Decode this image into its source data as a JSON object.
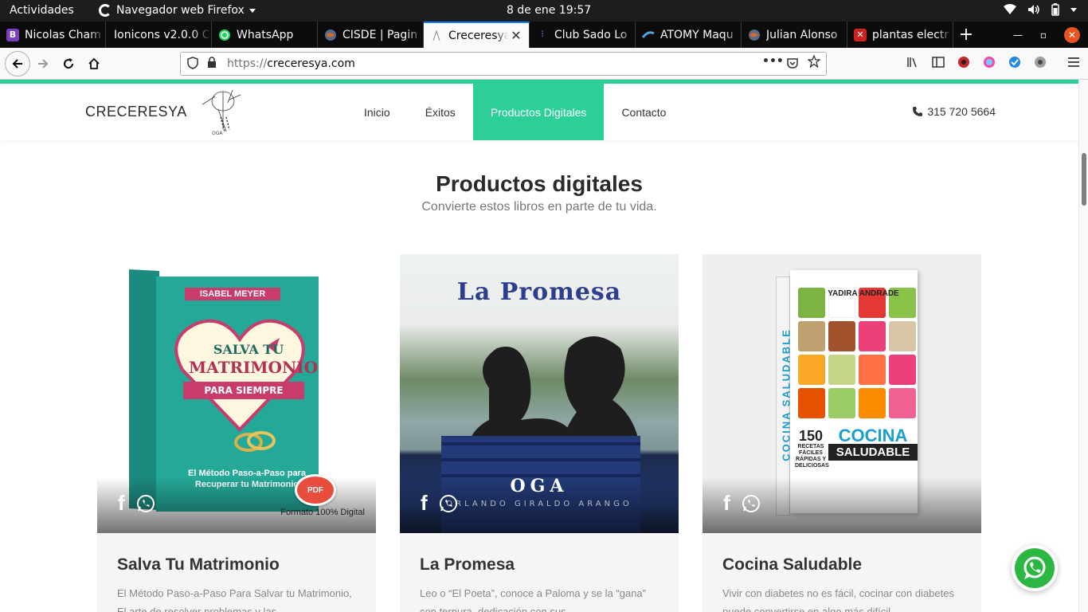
{
  "os_bar": {
    "activities": "Actividades",
    "app_name": "Navegador web Firefox",
    "clock": "8 de ene  19:57"
  },
  "tabs": [
    {
      "label": "Nicolas Cham",
      "favicon_color": "#7b3fbf",
      "favicon_char": "B",
      "active": false
    },
    {
      "label": "Ionicons v2.0.0 C",
      "favicon_color": "#0c0c0d",
      "favicon_char": "",
      "active": false
    },
    {
      "label": "WhatsApp",
      "favicon_color": "#25d366",
      "favicon_char": "",
      "active": false
    },
    {
      "label": "CISDE | Pagin",
      "favicon_color": "#5a6b8a",
      "favicon_char": "",
      "active": false
    },
    {
      "label": "Creceresya",
      "favicon_color": "#cccccc",
      "favicon_char": "",
      "active": true
    },
    {
      "label": "Club Sado Lo",
      "favicon_color": "#1a3a8a",
      "favicon_char": "",
      "active": false
    },
    {
      "label": "ATOMY Maqu",
      "favicon_color": "#2a6ab5",
      "favicon_char": "",
      "active": false
    },
    {
      "label": "Julian Alonso",
      "favicon_color": "#5a6b8a",
      "favicon_char": "",
      "active": false
    },
    {
      "label": "plantas electr",
      "favicon_color": "#cc2222",
      "favicon_char": "",
      "active": false
    }
  ],
  "navbar": {
    "url_prefix": "https://",
    "url_domain": "creceresya.com"
  },
  "site": {
    "logo_text": "CRECERESYA",
    "menu": [
      {
        "label": "Inicio",
        "active": false
      },
      {
        "label": "Éxitos",
        "active": false
      },
      {
        "label": "Productos Digitales",
        "active": true
      },
      {
        "label": "Contacto",
        "active": false
      }
    ],
    "phone": "315 720 5664"
  },
  "section": {
    "title": "Productos digitales",
    "subtitle": "Convierte estos libros en parte de tu vida."
  },
  "products": [
    {
      "title": "Salva Tu Matrimonio",
      "description": "El Método Paso-a-Paso Para Salvar tu Matrimonio, El arte de resolver problemas y las",
      "cover": {
        "author": "ISABEL MEYER",
        "line1": "SALVA TU",
        "line2": "MATRIMONIO",
        "ribbon": "PARA SIEMPRE",
        "subtitle": "El Método Paso-a-Paso para Recuperar tu Matrimonio",
        "badge": "PDF",
        "format": "Formato 100% Digital"
      }
    },
    {
      "title": "La Promesa",
      "description": "Leo o “El Poeta”, conoce a Paloma y se la “gana” con ternura, dedicación con sus",
      "cover": {
        "title": "La Promesa",
        "brand": "OGA",
        "author": "ORLANDO GIRALDO ARANGO"
      }
    },
    {
      "title": "Cocina Saludable",
      "description": "Vivir con diabetes no es fácil, cocinar con diabetes puede convertirse en algo más difícil",
      "cover": {
        "author": "YADIRA ANDRADE",
        "spine": "COCINA SALUDABLE",
        "number": "150",
        "recipes": "RECETAS FÁCILES RÁPIDAS Y DELICIOSAS",
        "big1": "COCINA",
        "big2": "SALUDABLE"
      }
    }
  ],
  "colors": {
    "accent": "#2ccf9a",
    "whatsapp": "#2bb741"
  }
}
